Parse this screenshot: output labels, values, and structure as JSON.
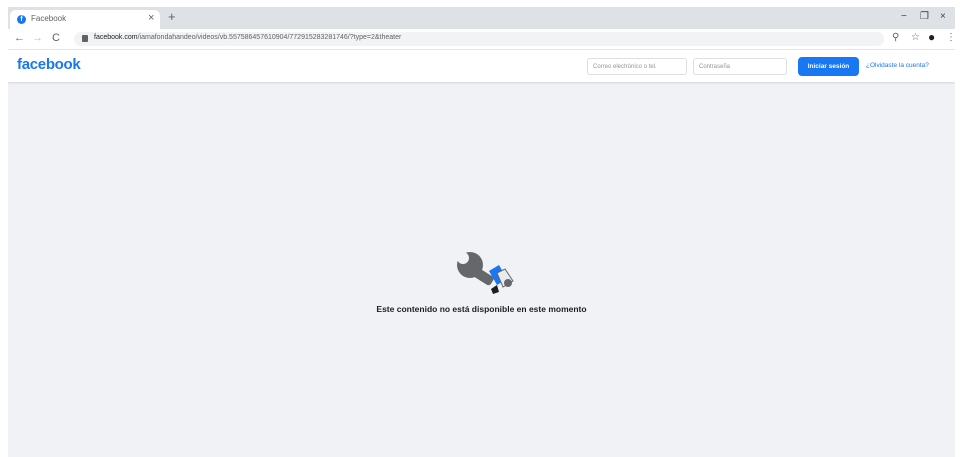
{
  "browser": {
    "tab_title": "Facebook",
    "tab_close": "×",
    "new_tab": "+",
    "window_controls": {
      "minimize": "−",
      "restore": "❐",
      "close": "×"
    },
    "nav": {
      "back": "←",
      "forward": "→",
      "reload": "C"
    },
    "url_host": "facebook.com",
    "url_path": "/iamafondahandeo/videos/vb.557586457610904/772915283281746/?type=2&theater"
  },
  "header": {
    "logo": "facebook",
    "email_placeholder": "Correo electrónico o tel.",
    "password_placeholder": "Contraseña",
    "login_label": "Iniciar sesión",
    "forgot_label": "¿Olvidaste la cuenta?"
  },
  "content": {
    "message": "Este contenido no está disponible en este momento"
  },
  "colors": {
    "brand": "#1877f2",
    "background": "#f0f2f5"
  }
}
